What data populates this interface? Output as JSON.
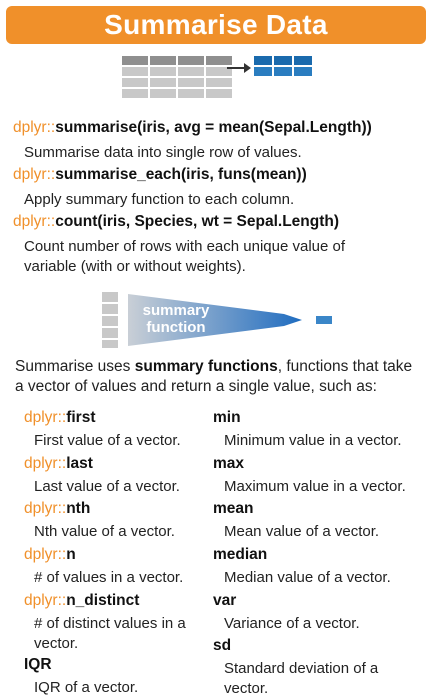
{
  "title": "Summarise Data",
  "functions": [
    {
      "pkg": "dplyr::",
      "call": "summarise(iris, avg = mean(Sepal.Length))",
      "desc": "Summarise data into single row of values."
    },
    {
      "pkg": "dplyr::",
      "call": "summarise_each(iris, funs(mean))",
      "desc": "Apply summary function to each column."
    },
    {
      "pkg": "dplyr::",
      "call": "count(iris, Species, wt = Sepal.Length)",
      "desc": "Count number of rows with each unique value of variable (with or without weights)."
    }
  ],
  "diagram": {
    "label_line1": "summary",
    "label_line2": "function"
  },
  "intro": {
    "pre": "Summarise uses ",
    "bold": "summary functions",
    "post": ", functions that take a vector of values and return a single value, such as:"
  },
  "left_col": [
    {
      "pkg": "dplyr::",
      "name": "first",
      "desc": "First value of a vector."
    },
    {
      "pkg": "dplyr::",
      "name": "last",
      "desc": "Last value of a vector."
    },
    {
      "pkg": "dplyr::",
      "name": "nth",
      "desc": "Nth value of a vector."
    },
    {
      "pkg": "dplyr::",
      "name": "n",
      "desc": "# of values in a vector."
    },
    {
      "pkg": "dplyr::",
      "name": "n_distinct",
      "desc": "# of distinct values in a vector."
    },
    {
      "pkg": "",
      "name": "IQR",
      "desc": "IQR of a vector."
    }
  ],
  "right_col": [
    {
      "name": "min",
      "desc": "Minimum value in a vector."
    },
    {
      "name": "max",
      "desc": "Maximum value in a vector."
    },
    {
      "name": "mean",
      "desc": "Mean value of a vector."
    },
    {
      "name": "median",
      "desc": "Median value of a vector."
    },
    {
      "name": "var",
      "desc": "Variance of a vector."
    },
    {
      "name": "sd",
      "desc": "Standard deviation of a vector."
    }
  ],
  "colors": {
    "accent": "#f0902a",
    "blue": "#2a7dc0",
    "grey": "#c8c8c8"
  }
}
